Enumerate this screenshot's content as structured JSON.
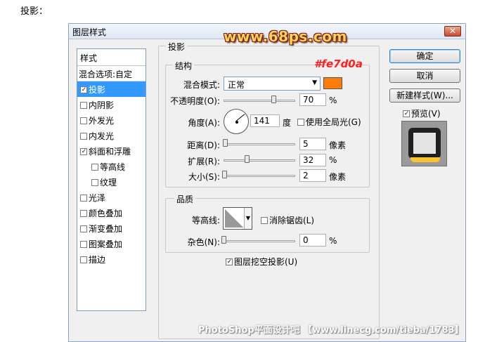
{
  "caption": "投影：",
  "dialog": {
    "title": "图层样式",
    "close_glyph": "✕"
  },
  "watermark_top": "www.68ps.com",
  "hex_annotation": "#fe7d0a",
  "styles_panel": {
    "header": "样式",
    "blend_options": "混合选项:自定",
    "items": [
      {
        "label": "投影",
        "checked": true,
        "selected": true
      },
      {
        "label": "内阴影",
        "checked": false
      },
      {
        "label": "外发光",
        "checked": false
      },
      {
        "label": "内发光",
        "checked": false
      },
      {
        "label": "斜面和浮雕",
        "checked": true
      },
      {
        "label": "等高线",
        "checked": false,
        "sub": true
      },
      {
        "label": "纹理",
        "checked": false,
        "sub": true
      },
      {
        "label": "光泽",
        "checked": false
      },
      {
        "label": "颜色叠加",
        "checked": false
      },
      {
        "label": "渐变叠加",
        "checked": false
      },
      {
        "label": "图案叠加",
        "checked": false
      },
      {
        "label": "描边",
        "checked": false
      }
    ]
  },
  "drop_shadow": {
    "section_title": "投影",
    "structure_title": "结构",
    "blend_mode_label": "混合模式:",
    "blend_mode_value": "正常",
    "shadow_color": "#fe7d0a",
    "opacity_label": "不透明度(O):",
    "opacity_value": "70",
    "opacity_unit": "%",
    "opacity_fraction": 0.7,
    "angle_label": "角度(A):",
    "angle_value": "141",
    "angle_unit": "度",
    "global_light_label": "使用全局光(G)",
    "global_light_checked": false,
    "distance_label": "距离(D):",
    "distance_value": "5",
    "distance_unit": "像素",
    "distance_fraction": 0.02,
    "spread_label": "扩展(R):",
    "spread_value": "32",
    "spread_unit": "%",
    "spread_fraction": 0.32,
    "size_label": "大小(S):",
    "size_value": "2",
    "size_unit": "像素",
    "size_fraction": 0.01,
    "quality_title": "品质",
    "contour_label": "等高线:",
    "antialias_label": "消除锯齿(L)",
    "antialias_checked": false,
    "noise_label": "杂色(N):",
    "noise_value": "0",
    "noise_unit": "%",
    "noise_fraction": 0,
    "knockout_label": "图层挖空投影(U)",
    "knockout_checked": true
  },
  "buttons": {
    "ok": "确定",
    "cancel": "取消",
    "new_style": "新建样式(W)...",
    "preview_label": "预览(V)",
    "preview_checked": true
  },
  "watermark_bottom": "PhotoShop平面设计吧 【www.linecg.com/tieba/1783】"
}
